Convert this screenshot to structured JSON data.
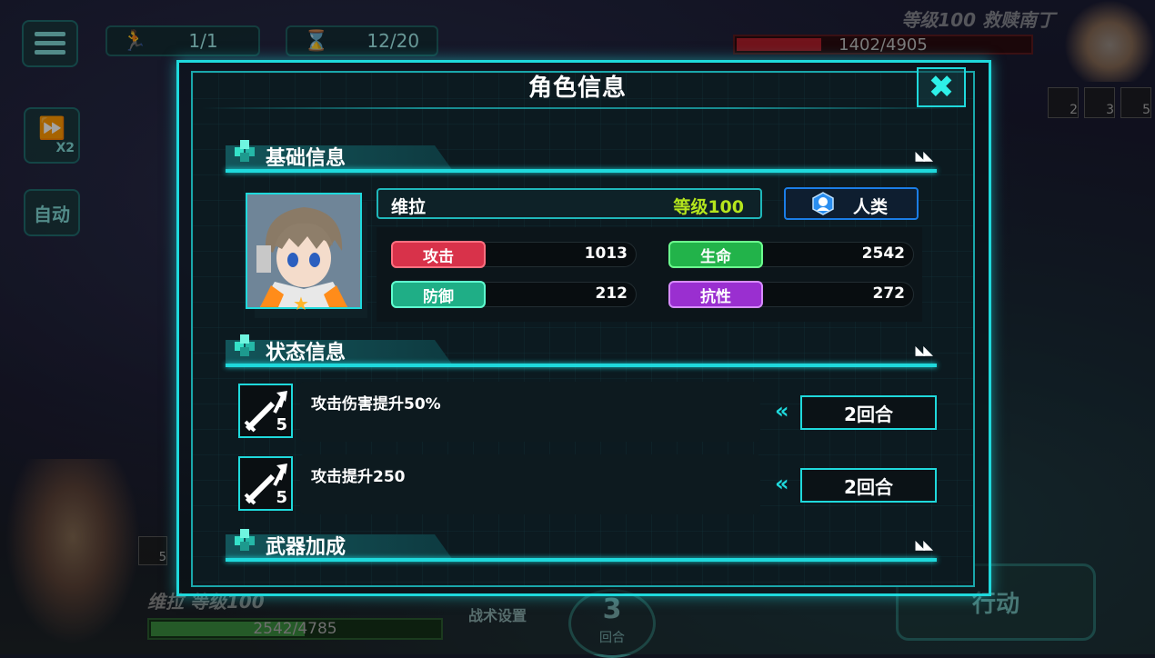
{
  "hud": {
    "turn_count": "1/1",
    "time_count": "12/20",
    "speed_label": "X2",
    "auto_label": "自动"
  },
  "enemy": {
    "level_name": "等级100  救赎南丁",
    "hp_text": "1402/4905",
    "hp_fraction": 0.286,
    "buff_counts": [
      "2",
      "3",
      "5"
    ]
  },
  "player": {
    "name_level": "维拉  等级100",
    "hp_text": "2542/4785",
    "hp_fraction": 0.531,
    "buff_count": "5"
  },
  "bottom": {
    "tactic_label": "战术设置",
    "round_number": "3",
    "round_label": "回合",
    "action_label": "行动"
  },
  "modal": {
    "title": "角色信息",
    "sections": {
      "basic": "基础信息",
      "status": "状态信息",
      "weapon": "武器加成"
    },
    "character": {
      "name": "维拉",
      "level": "等级100",
      "race": "人类"
    },
    "stats": [
      {
        "label": "攻击",
        "value": "1013",
        "color": "#d8324a",
        "border": "#ff7080"
      },
      {
        "label": "生命",
        "value": "2542",
        "color": "#22b34a",
        "border": "#6cff8e"
      },
      {
        "label": "防御",
        "value": "212",
        "color": "#1fae86",
        "border": "#5fffd0"
      },
      {
        "label": "抗性",
        "value": "272",
        "color": "#9a2fd0",
        "border": "#d78bff"
      }
    ],
    "statuses": [
      {
        "desc": "攻击伤害提升50%",
        "stack": "5",
        "duration": "2回合"
      },
      {
        "desc": "攻击提升250",
        "stack": "5",
        "duration": "2回合"
      }
    ]
  },
  "colors": {
    "accent": "#1fd9dc",
    "level_green": "#b5e61d",
    "race_blue": "#1b7de6"
  }
}
